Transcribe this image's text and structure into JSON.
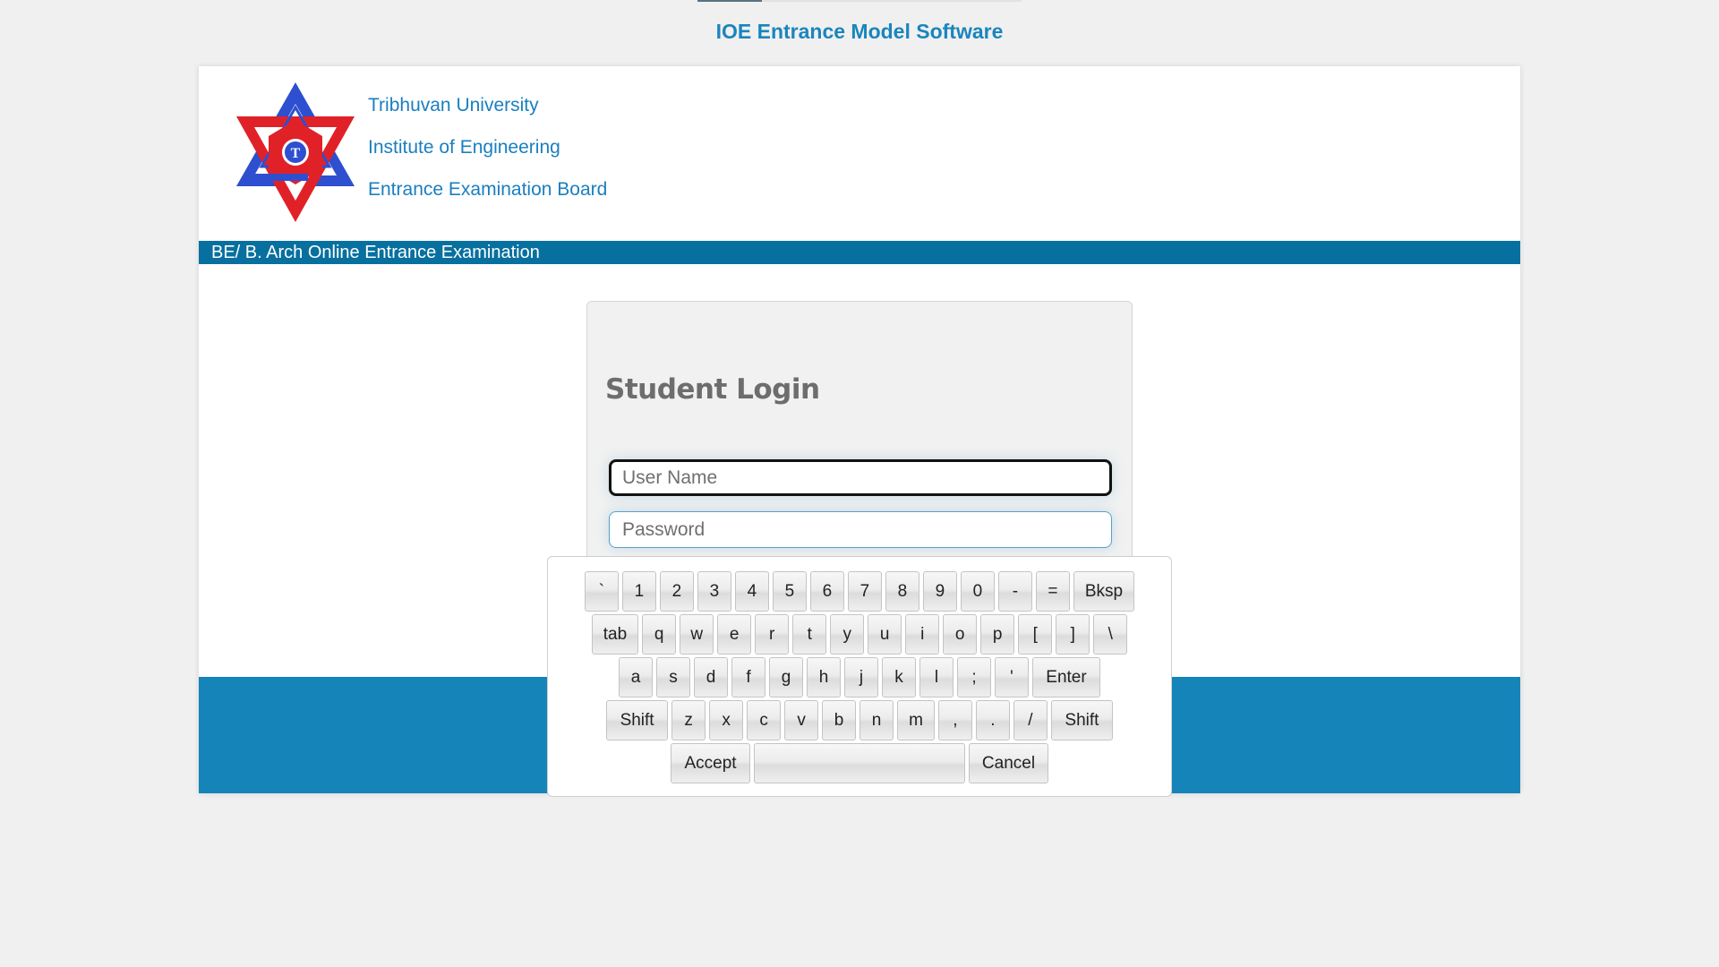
{
  "loading": {
    "progress_percent": 20
  },
  "app_title": "IOE Entrance Model Software",
  "header": {
    "org_lines": [
      "Tribhuvan University",
      "Institute of Engineering",
      "Entrance Examination Board"
    ],
    "logo": "tribhuvan-university-logo",
    "band_text": "BE/ B. Arch Online Entrance Examination"
  },
  "login": {
    "title": "Student Login",
    "username": {
      "value": "",
      "placeholder": "User Name"
    },
    "password": {
      "value": "",
      "placeholder": "Password"
    }
  },
  "keyboard": {
    "rows": [
      [
        "`",
        "1",
        "2",
        "3",
        "4",
        "5",
        "6",
        "7",
        "8",
        "9",
        "0",
        "-",
        "=",
        "Bksp"
      ],
      [
        "tab",
        "q",
        "w",
        "e",
        "r",
        "t",
        "y",
        "u",
        "i",
        "o",
        "p",
        "[",
        "]",
        "\\"
      ],
      [
        "a",
        "s",
        "d",
        "f",
        "g",
        "h",
        "j",
        "k",
        "l",
        ";",
        "'",
        "Enter"
      ],
      [
        "Shift",
        "z",
        "x",
        "c",
        "v",
        "b",
        "n",
        "m",
        ",",
        ".",
        "/",
        "Shift"
      ]
    ],
    "accept": "Accept",
    "space": "",
    "cancel": "Cancel"
  },
  "colors": {
    "title_blue": "#1a85bd",
    "band_blue": "#07709f",
    "footer_blue": "#1584b9",
    "logo_red": "#e02228",
    "logo_blue": "#2d4fd0"
  }
}
